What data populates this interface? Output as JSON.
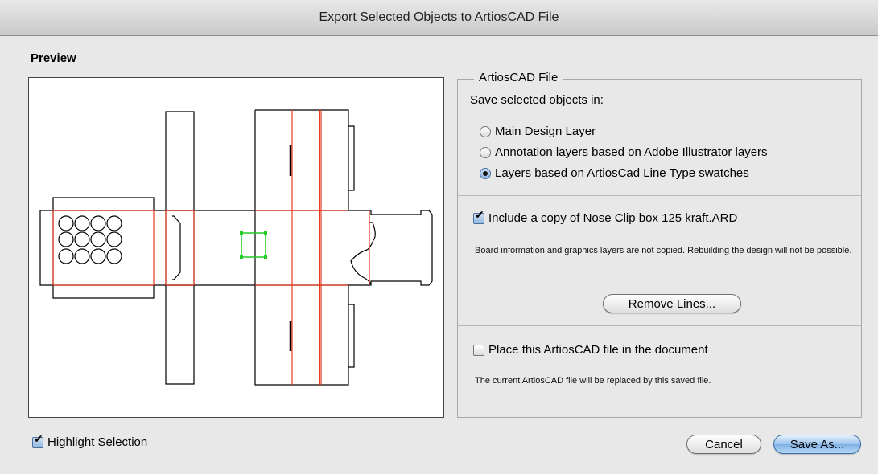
{
  "window": {
    "title": "Export Selected Objects to ArtiosCAD File"
  },
  "preview": {
    "label": "Preview"
  },
  "artioscad_group": {
    "legend": "ArtiosCAD File",
    "save_in_label": "Save selected objects in:",
    "options": [
      {
        "label": "Main Design Layer",
        "selected": false
      },
      {
        "label": "Annotation layers based on Adobe Illustrator layers",
        "selected": false
      },
      {
        "label": "Layers based on ArtiosCad Line Type swatches",
        "selected": true
      }
    ],
    "include_copy": {
      "label": "Include a copy of Nose Clip box 125 kraft.ARD",
      "checked": true,
      "note": "Board information and graphics layers are not copied.  Rebuilding the design will not be possible."
    },
    "remove_lines_button": "Remove Lines...",
    "place_file": {
      "label": "Place this ArtiosCAD file in the document",
      "checked": false,
      "note": "The current ArtiosCAD file will be replaced by this saved file."
    }
  },
  "highlight_selection": {
    "label": "Highlight Selection",
    "checked": true
  },
  "buttons": {
    "cancel": "Cancel",
    "save_as": "Save As..."
  },
  "colors": {
    "cut_line": "#000000",
    "crease_line": "#e8391d",
    "selection": "#22cc22",
    "default_button": "#7fb1e6"
  }
}
